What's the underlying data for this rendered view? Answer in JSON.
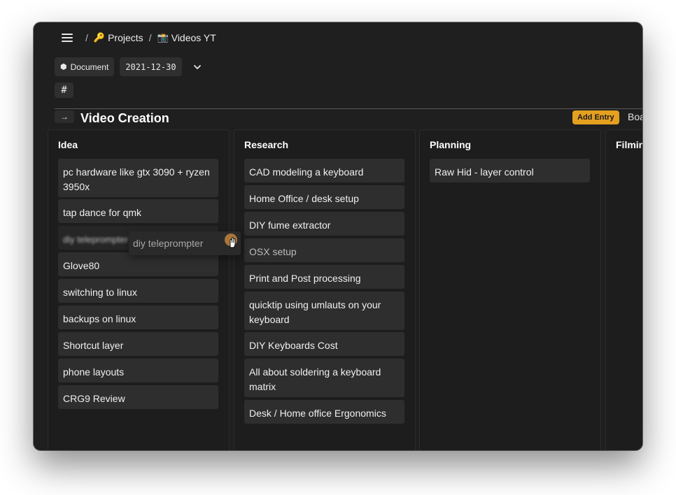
{
  "breadcrumb": {
    "projects_icon": "🔑",
    "projects_label": "Projects",
    "videos_icon": "📸",
    "videos_label": "Videos YT",
    "separator": "/"
  },
  "doc": {
    "type_icon": "⬢",
    "type_label": "Document",
    "date": "2021-12-30",
    "tag_symbol": "#"
  },
  "board": {
    "toggle_icon": "→",
    "title": "Video Creation",
    "add_entry_label": "Add Entry",
    "view_tab_label": "Boa"
  },
  "columns": [
    {
      "title": "Idea",
      "cards": [
        "pc hardware like gtx 3090 + ryzen 3950x",
        "tap dance for qmk",
        "Glove80",
        "switching to linux",
        "backups on linux",
        "Shortcut layer",
        "phone layouts",
        "CRG9 Review"
      ]
    },
    {
      "title": "Research",
      "cards": [
        "CAD modeling a keyboard",
        "Home Office / desk setup",
        "DIY fume extractor",
        "OSX setup",
        "Print and Post processing",
        "quicktip using umlauts on your keyboard",
        "DIY Keyboards Cost",
        "All about soldering a keyboard matrix",
        "Desk / Home office Ergonomics"
      ]
    },
    {
      "title": "Planning",
      "cards": [
        "Raw Hid - layer control"
      ]
    },
    {
      "title": "Filmin",
      "cards": []
    }
  ],
  "drag": {
    "ghost_label": "diy teleprompter",
    "placeholder_label": "diy teleprompter"
  },
  "colors": {
    "window_bg": "#1f1f1f",
    "card_bg": "#2e2e2e",
    "accent": "#e5a020"
  }
}
